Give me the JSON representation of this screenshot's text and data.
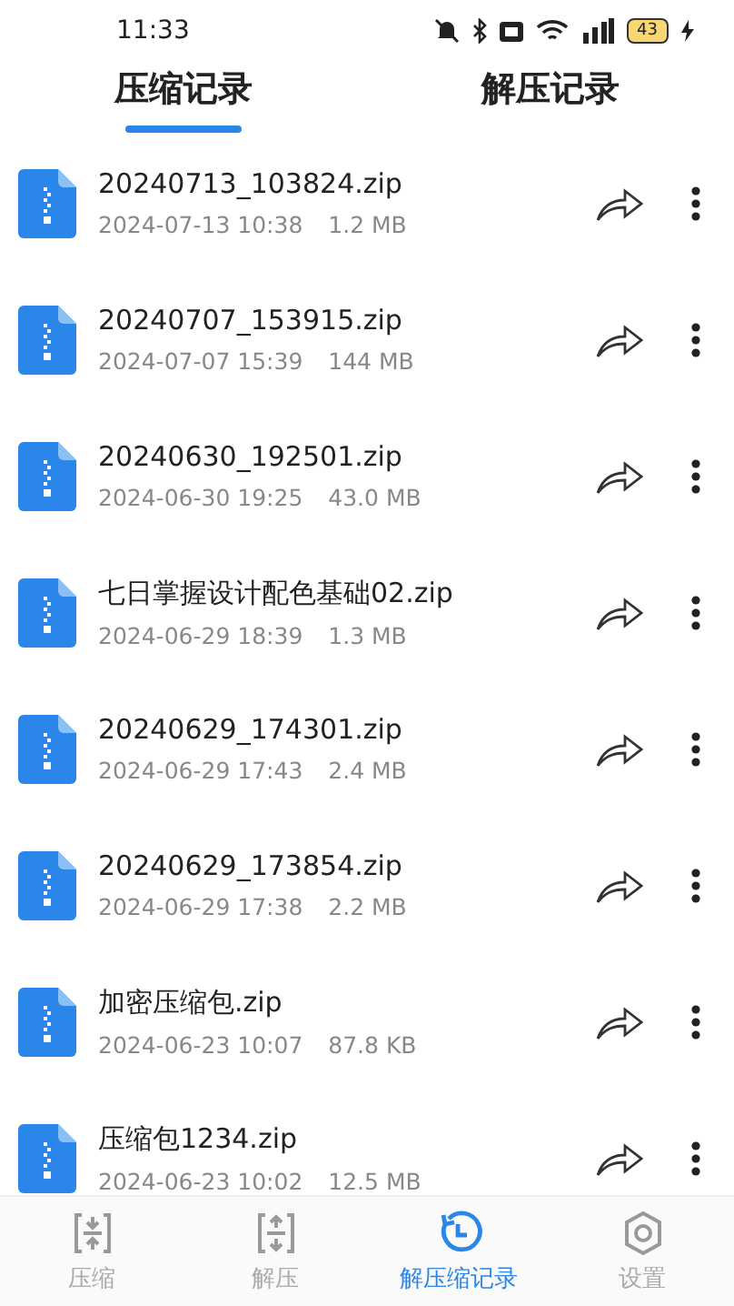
{
  "status_bar": {
    "time": "11:33",
    "battery": "43"
  },
  "tabs": [
    {
      "label": "压缩记录",
      "selected": true
    },
    {
      "label": "解压记录",
      "selected": false
    }
  ],
  "files": [
    {
      "name": "20240713_103824.zip",
      "date": "2024-07-13 10:38",
      "size": "1.2 MB"
    },
    {
      "name": "20240707_153915.zip",
      "date": "2024-07-07 15:39",
      "size": "144 MB"
    },
    {
      "name": "20240630_192501.zip",
      "date": "2024-06-30 19:25",
      "size": "43.0 MB"
    },
    {
      "name": "七日掌握设计配色基础02.zip",
      "date": "2024-06-29 18:39",
      "size": "1.3 MB"
    },
    {
      "name": "20240629_174301.zip",
      "date": "2024-06-29 17:43",
      "size": "2.4 MB"
    },
    {
      "name": "20240629_173854.zip",
      "date": "2024-06-29 17:38",
      "size": "2.2 MB"
    },
    {
      "name": "加密压缩包.zip",
      "date": "2024-06-23 10:07",
      "size": "87.8 KB"
    },
    {
      "name": "压缩包1234.zip",
      "date": "2024-06-23 10:02",
      "size": "12.5 MB"
    }
  ],
  "bottom_nav": [
    {
      "label": "压缩",
      "kind": "compress",
      "selected": false
    },
    {
      "label": "解压",
      "kind": "extract",
      "selected": false
    },
    {
      "label": "解压缩记录",
      "kind": "history",
      "selected": true
    },
    {
      "label": "设置",
      "kind": "settings",
      "selected": false
    }
  ]
}
